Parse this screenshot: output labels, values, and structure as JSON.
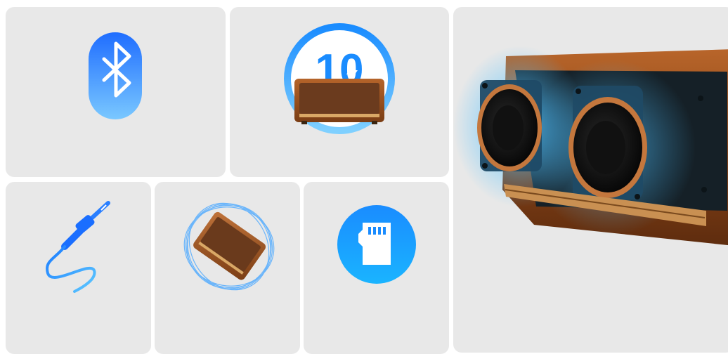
{
  "features": {
    "bluetooth": {
      "icon": "bluetooth-icon"
    },
    "battery": {
      "icon": "battery-badge-icon",
      "value": "10"
    },
    "aux": {
      "icon": "aux-cable-icon"
    },
    "surround": {
      "icon": "speaker-360-icon"
    },
    "tf_card": {
      "icon": "sd-card-icon"
    },
    "drivers": {
      "icon": "speaker-driver-icon"
    }
  },
  "colors": {
    "tile_bg": "#e8e8e8",
    "accent_blue": "#1a8cff",
    "light_blue": "#6cc4ff",
    "wood": "#8a4a1c",
    "gold": "#c9944a"
  }
}
